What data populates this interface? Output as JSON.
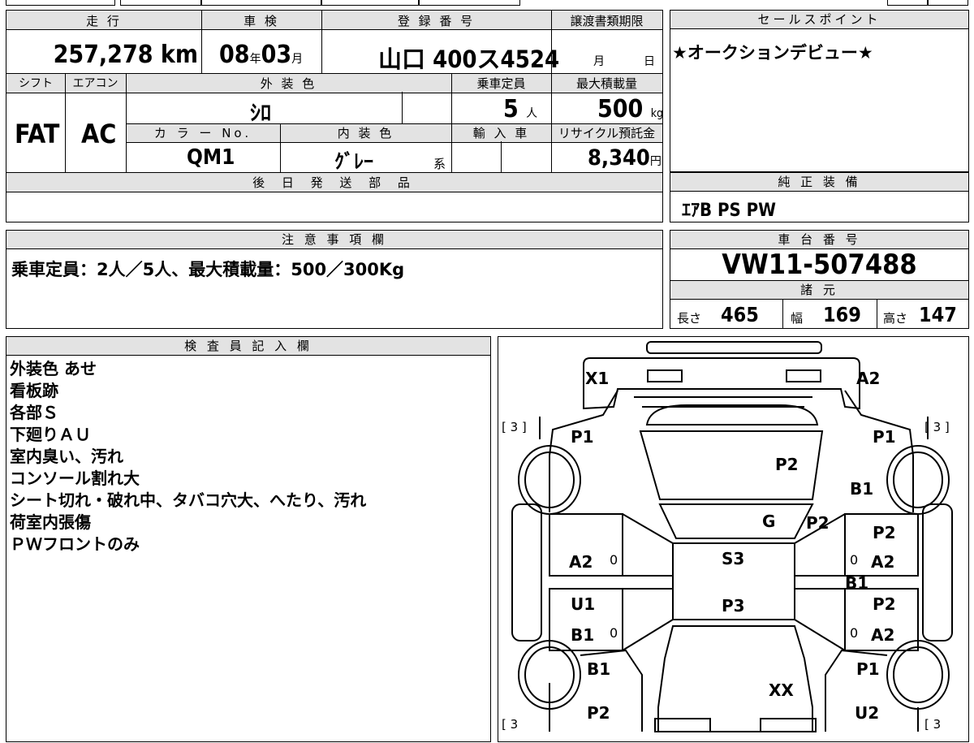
{
  "summary": {
    "mileage_header": "走 行",
    "mileage_value": "257,278",
    "mileage_unit": "km",
    "inspection_header": "車 検",
    "inspection_year": "08",
    "inspection_year_unit": "年",
    "inspection_month": "03",
    "inspection_month_unit": "月",
    "registration_header": "登 録 番 号",
    "registration_value": "山口 400ス4524",
    "transfer_header": "譲渡書類期限",
    "transfer_month_unit": "月",
    "transfer_day_unit": "日",
    "shift_header": "シフト",
    "shift_value": "FAT",
    "ac_header": "エアコン",
    "ac_value": "AC",
    "exterior_color_header": "外 装 色",
    "exterior_color_value": "ｼﾛ",
    "capacity_header": "乗車定員",
    "capacity_value": "5",
    "capacity_unit": "人",
    "max_load_header": "最大積載量",
    "max_load_value": "500",
    "max_load_unit": "kg",
    "color_no_header": "カ ラ ー No.",
    "color_no_value": "QM1",
    "interior_color_header": "内 装 色",
    "interior_color_value": "ｸﾞﾚｰ",
    "interior_color_suffix": "系",
    "import_header": "輸 入 車",
    "recycle_header": "リサイクル預託金",
    "recycle_value": "8,340",
    "recycle_unit": "円",
    "later_parts_header": "後 日 発 送 部 品",
    "later_parts_value": ""
  },
  "sales_point": {
    "header": "セールスポイント",
    "text": "★オークションデビュー★"
  },
  "genuine_equipment": {
    "header": "純 正 装 備",
    "text": "ｴｱB PS PW"
  },
  "notes": {
    "header": "注 意 事 項 欄",
    "text": "乗車定員：2人／5人、最大積載量：500／300Kg"
  },
  "chassis": {
    "header": "車 台 番 号",
    "value": "VW11-507488"
  },
  "specs": {
    "header": "諸 元",
    "length_label": "長さ",
    "length_value": "465",
    "width_label": "幅",
    "width_value": "169",
    "height_label": "高さ",
    "height_value": "147"
  },
  "inspector": {
    "header": "検 査 員 記 入 欄",
    "lines": [
      "外装色 あせ",
      "看板跡",
      "各部Ｓ",
      "下廻りＡＵ",
      "室内臭い、汚れ",
      "コンソール割れ大",
      "シート切れ・破れ中、タバコ穴大、へたり、汚れ",
      "荷室内張傷",
      "ＰＷフロントのみ"
    ]
  },
  "diagram": {
    "tire_front_left": "[ 3 ]",
    "tire_front_right": "[ 3 ]",
    "tire_rear_left": "[ 3",
    "tire_rear_right": "[ 3",
    "marks": {
      "front_left_corner": "X1",
      "front_right_corner": "A2",
      "left_front_fender": "P1",
      "right_front_fender": "P1",
      "hood": "P2",
      "right_fender_b": "B1",
      "windshield": "G",
      "right_a_pillar": "P2",
      "right_front_door_p": "P2",
      "left_front_door": "A2",
      "left_front_door_zero": "0",
      "roof": "S3",
      "right_front_door_zero": "0",
      "right_front_door_a": "A2",
      "right_rocker": "B1",
      "left_rear_door_u": "U1",
      "roof_rear": "P3",
      "right_rear_door_p": "P2",
      "left_rear_door_b": "B1",
      "left_rear_door_zero": "0",
      "right_rear_door_zero": "0",
      "right_rear_door_a": "A2",
      "left_rear_fender_b": "B1",
      "right_rear_fender_p": "P1",
      "tailgate": "XX",
      "left_rear_corner": "P2",
      "right_rear_corner": "U2"
    }
  }
}
